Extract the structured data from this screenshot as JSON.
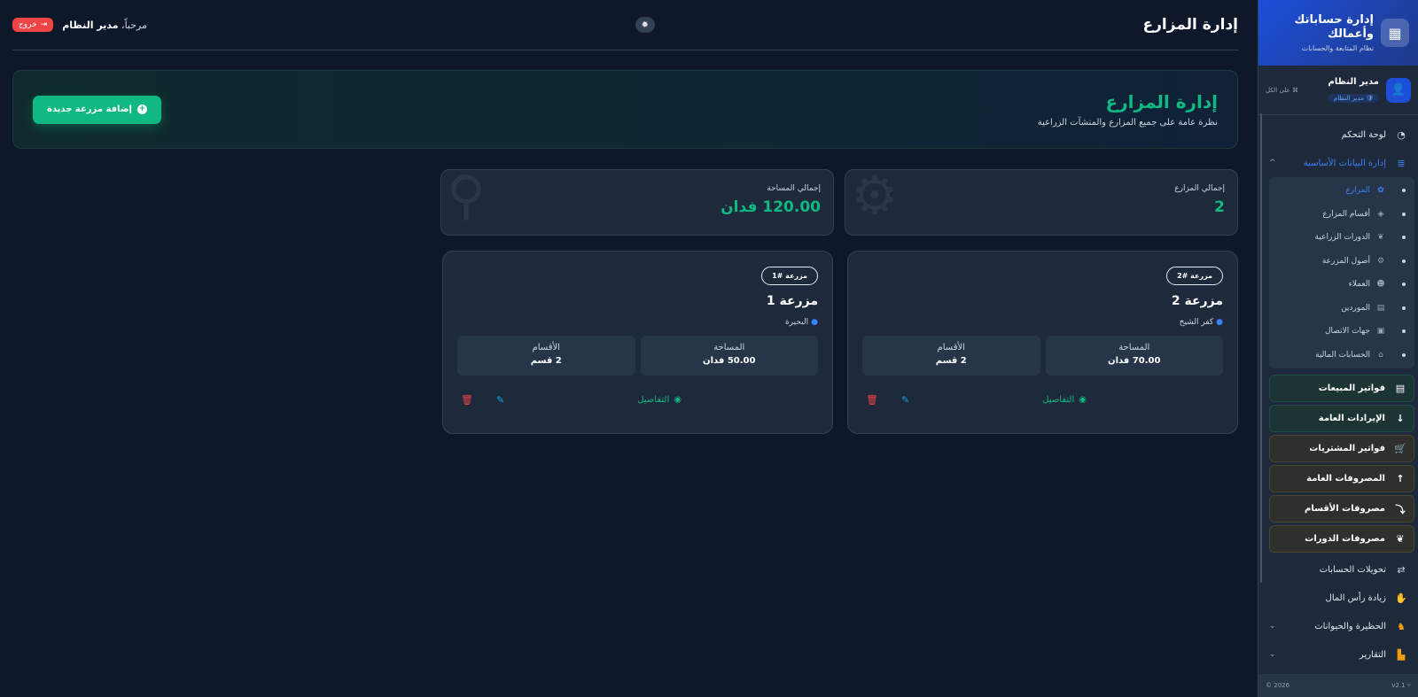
{
  "sidebar": {
    "brand_title": "إدارة حساباتك وأعمالك",
    "brand_subtitle": "نظام المتابعة والحسابات",
    "brand_icon": "calculator-icon",
    "user": {
      "name": "مدير النظام",
      "role": "مدير النظام",
      "scope": "على الكل"
    },
    "items": [
      {
        "label": "لوحة التحكم",
        "icon": "dashboard-icon"
      },
      {
        "label": "إدارة البيانات الأساسية",
        "icon": "database-icon"
      }
    ],
    "subitems": [
      {
        "label": "المزارع",
        "icon": "seedling-icon"
      },
      {
        "label": "أقسام المزارع",
        "icon": "layers-icon"
      },
      {
        "label": "الدورات الزراعية",
        "icon": "leaf-icon"
      },
      {
        "label": "أصول المزرعة",
        "icon": "gears-icon"
      },
      {
        "label": "العملاء",
        "icon": "users-icon"
      },
      {
        "label": "الموردين",
        "icon": "truck-icon"
      },
      {
        "label": "جهات الاتصال",
        "icon": "address-book-icon"
      },
      {
        "label": "الحسابات المالية",
        "icon": "bank-icon"
      }
    ],
    "boxed": [
      {
        "label": "فواتير المبيعات",
        "icon": "invoice-icon",
        "tone": "green"
      },
      {
        "label": "الإيرادات العامة",
        "icon": "arrow-down-icon",
        "tone": "green"
      },
      {
        "label": "فواتير المشتريات",
        "icon": "cart-icon",
        "tone": "amber"
      },
      {
        "label": "المصروفات العامة",
        "icon": "arrow-up-icon",
        "tone": "amber"
      },
      {
        "label": "مصروفات الأقسام",
        "icon": "split-arrow-icon",
        "tone": "amber"
      },
      {
        "label": "مصروفات الدورات",
        "icon": "leaf-icon",
        "tone": "amber"
      }
    ],
    "bottom": [
      {
        "label": "تحويلات الحسابات",
        "icon": "exchange-icon"
      },
      {
        "label": "زيادة رأس المال",
        "icon": "hand-money-icon"
      },
      {
        "label": "الحظيرة والحيوانات",
        "icon": "horse-icon"
      },
      {
        "label": "التقارير",
        "icon": "chart-icon"
      }
    ],
    "version": "v2.1",
    "copyright": "2026 ©"
  },
  "header": {
    "title": "إدارة المزارع",
    "welcome_prefix": "مرحباً،",
    "welcome_name": "مدير النظام",
    "logout_label": "خروج"
  },
  "hero": {
    "title": "إدارة المزارع",
    "subtitle": "نظرة عامة على جميع المزارع والمنشآت الزراعية",
    "add_button": "إضافة مزرعة جديدة"
  },
  "stats": [
    {
      "label": "إجمالي المزارع",
      "value": "2",
      "icon": "gears-icon"
    },
    {
      "label": "إجمالي المساحة",
      "value": "120.00 فدان",
      "icon": "map-pin-icon"
    }
  ],
  "farms": [
    {
      "badge": "مزرعة #2",
      "name": "مزرعة 2",
      "location": "كفر الشيخ",
      "area_label": "المساحة",
      "area_value": "70.00 فدان",
      "sections_label": "الأقسام",
      "sections_value": "2 قسم",
      "details_label": "التفاصيل"
    },
    {
      "badge": "مزرعة #1",
      "name": "مزرعة 1",
      "location": "البحيرة",
      "area_label": "المساحة",
      "area_value": "50.00 فدان",
      "sections_label": "الأقسام",
      "sections_value": "2 قسم",
      "details_label": "التفاصيل"
    }
  ],
  "colors": {
    "accent": "#10b981",
    "primary": "#3b82f6",
    "danger": "#ef4444",
    "background": "#0f172a",
    "surface": "#1e293b"
  }
}
